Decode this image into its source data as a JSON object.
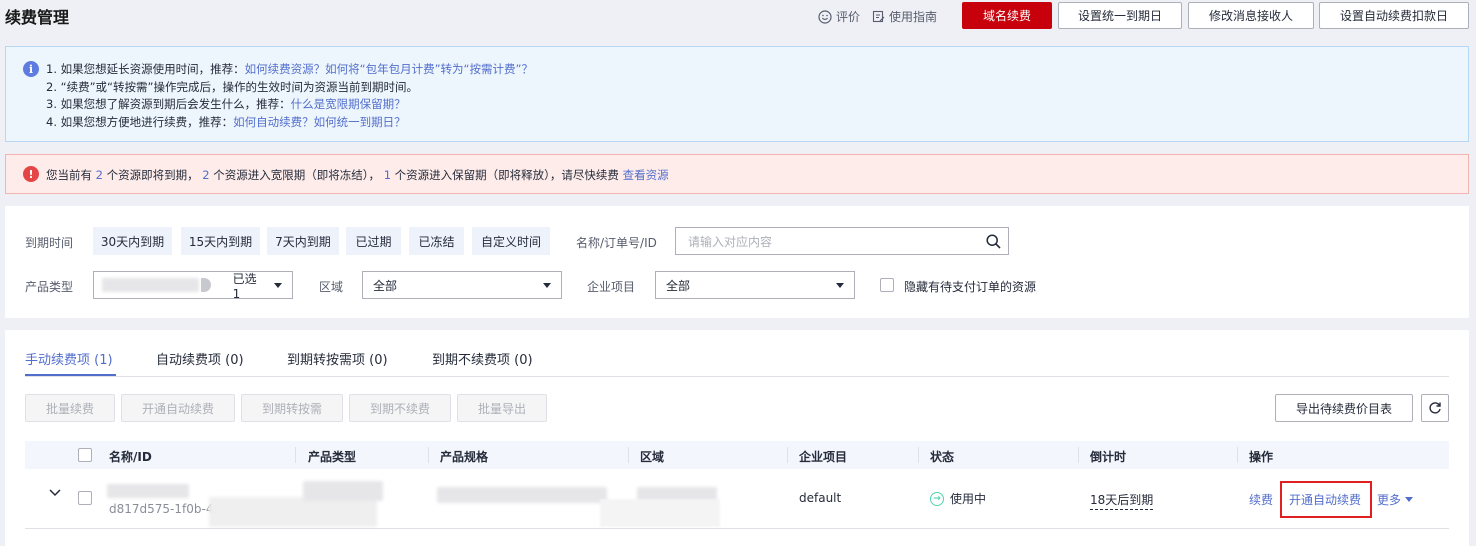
{
  "header": {
    "title": "续费管理",
    "rate_label": "评价",
    "guide_label": "使用指南",
    "btn_domain": "域名续费",
    "btn_unify_date": "设置统一到期日",
    "btn_recipient": "修改消息接收人",
    "btn_auto_deduct": "设置自动续费扣款日"
  },
  "info": {
    "line1_text": "1. 如果您想延长资源使用时间，推荐：",
    "line1_link": "如何续费资源？如何将“包年包月计费”转为“按需计费”？",
    "line2_text": "2. “续费”或“转按需”操作完成后，操作的生效时间为资源当前到期时间。",
    "line3_text": "3. 如果您想了解资源到期后会发生什么，推荐：",
    "line3_link": "什么是宽限期保留期？",
    "line4_text": "4. 如果您想方便地进行续费，推荐：",
    "line4_link": "如何自动续费？如何统一到期日？"
  },
  "warning": {
    "t1": "您当前有",
    "n1": "2",
    "t2": "个资源即将到期，",
    "n2": "2",
    "t3": "个资源进入宽限期（即将冻结），",
    "n3": "1",
    "t4": "个资源进入保留期（即将释放），请尽快续费",
    "link": "查看资源"
  },
  "filter": {
    "expiry_label": "到期时间",
    "chips": [
      "30天内到期",
      "15天内到期",
      "7天内到期",
      "已过期",
      "已冻结",
      "自定义时间"
    ],
    "name_label": "名称/订单号/ID",
    "search_placeholder": "请输入对应内容",
    "product_label": "产品类型",
    "product_selected": "已选 1",
    "region_label": "区域",
    "region_value": "全部",
    "project_label": "企业项目",
    "project_value": "全部",
    "hide_label": "隐藏有待支付订单的资源"
  },
  "tabs": [
    "手动续费项 (1)",
    "自动续费项 (0)",
    "到期转按需项 (0)",
    "到期不续费项 (0)"
  ],
  "actions": {
    "batch_renew": "批量续费",
    "enable_auto": "开通自动续费",
    "to_ondemand": "到期转按需",
    "no_renew": "到期不续费",
    "batch_export": "批量导出",
    "export_price": "导出待续费价目表"
  },
  "table": {
    "headers": [
      "名称/ID",
      "产品类型",
      "产品规格",
      "区域",
      "企业项目",
      "状态",
      "倒计时",
      "操作"
    ],
    "row": {
      "id": "d817d575-1f0b-45",
      "project": "default",
      "status": "使用中",
      "countdown": "18天后到期",
      "op_renew": "续费",
      "op_auto": "开通自动续费",
      "op_more": "更多"
    }
  }
}
